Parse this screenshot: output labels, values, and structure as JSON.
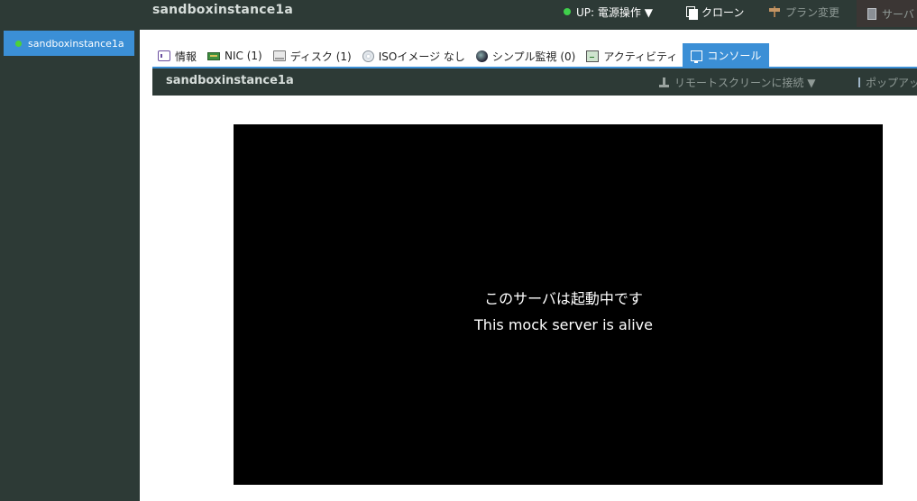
{
  "sidebar": {
    "items": [
      {
        "label": "sandboxinstance1a",
        "status_color": "#4cd137"
      }
    ]
  },
  "header": {
    "title": "sandboxinstance1a",
    "power_label": "UP: 電源操作 ▼",
    "clone_label": "クローン",
    "plan_label": "プラン変更",
    "server_label": "サーバ"
  },
  "tabs": [
    {
      "label": "情報",
      "icon": "info-icon"
    },
    {
      "label": "NIC (1)",
      "icon": "nic-icon"
    },
    {
      "label": "ディスク (1)",
      "icon": "disk-icon"
    },
    {
      "label": "ISOイメージ なし",
      "icon": "iso-icon"
    },
    {
      "label": "シンプル監視 (0)",
      "icon": "monitor-icon"
    },
    {
      "label": "アクティビティ",
      "icon": "activity-icon"
    },
    {
      "label": "コンソール",
      "icon": "console-icon",
      "active": true
    }
  ],
  "subbar": {
    "title": "sandboxinstance1a",
    "remote_label": "リモートスクリーンに接続 ▼",
    "popup_label": "ポップアップ"
  },
  "console": {
    "line1": "このサーバは起動中です",
    "line2": "This mock server is alive"
  },
  "colors": {
    "accent": "#3b8fd6",
    "dark": "#2d3a36",
    "status_up": "#3fcf4b"
  }
}
